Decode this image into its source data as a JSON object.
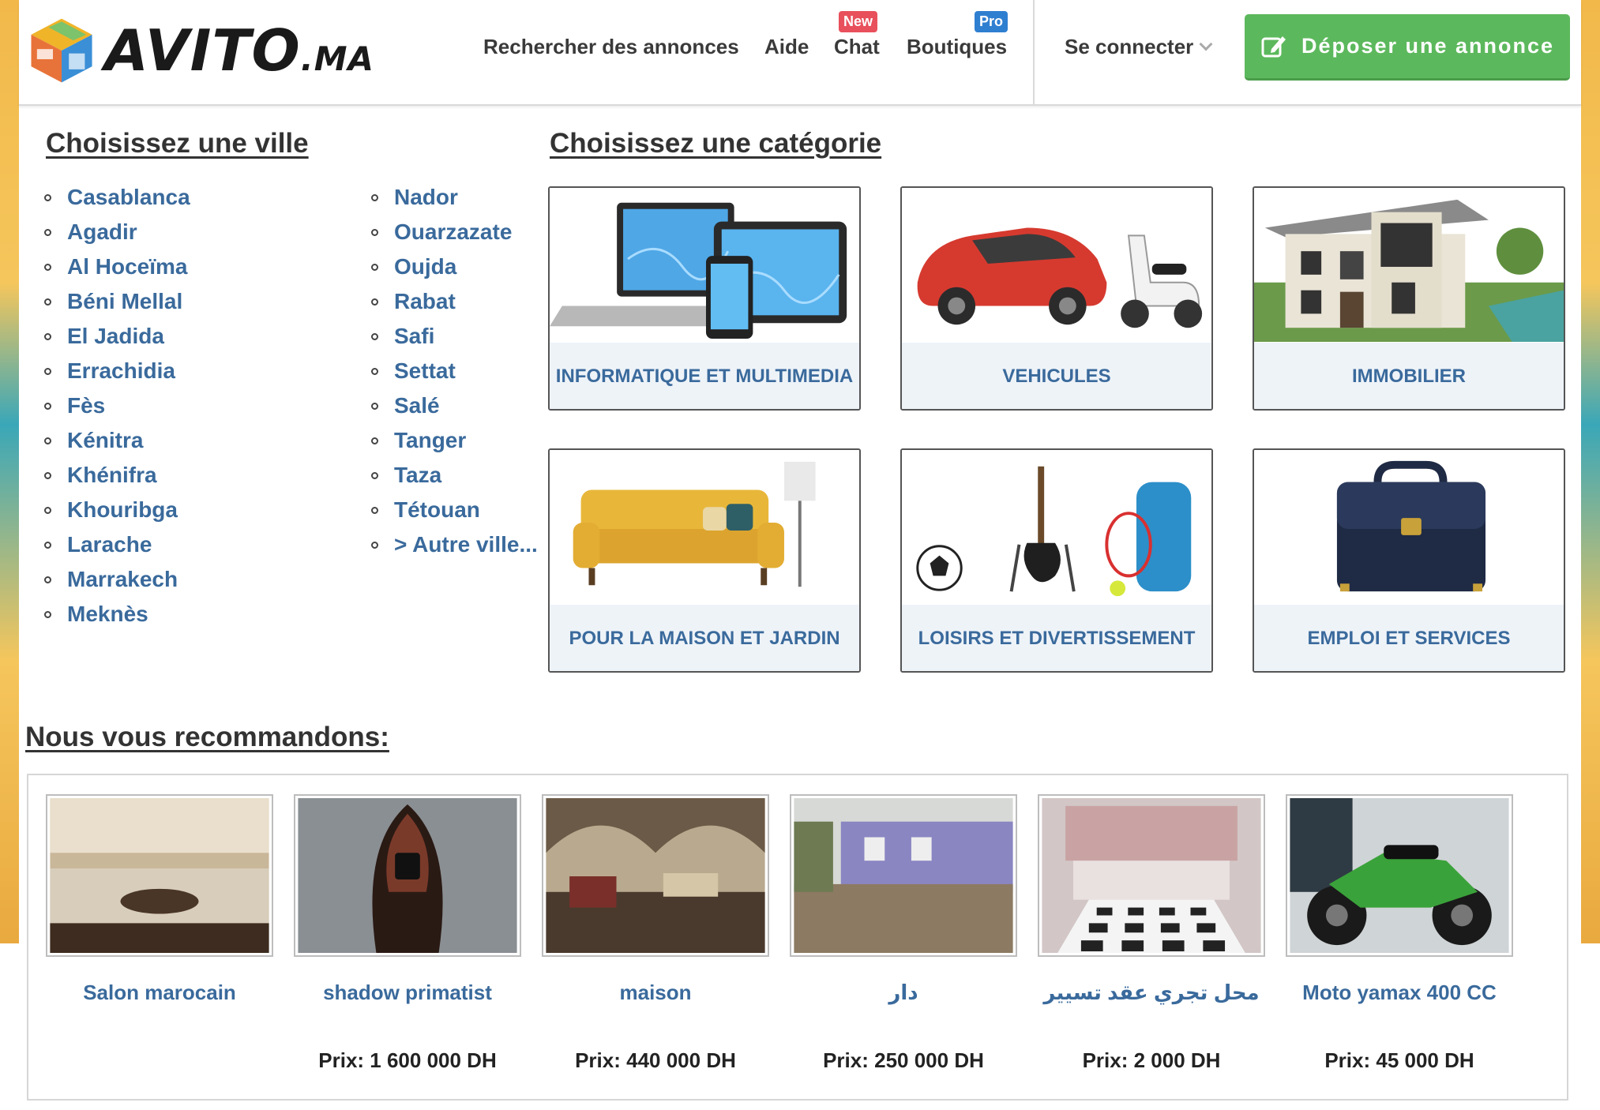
{
  "brand": {
    "name": "AVITO",
    "tld": ".MA",
    "green": "#5cb85c",
    "link_blue": "#3a6a9c"
  },
  "nav": {
    "search": "Rechercher des annonces",
    "help": "Aide",
    "chat": "Chat",
    "chat_badge": "New",
    "shops": "Boutiques",
    "shops_badge": "Pro",
    "login": "Se connecter",
    "post_ad": "Déposer une annonce"
  },
  "cities": {
    "heading": "Choisissez une ville",
    "col1": [
      "Casablanca",
      "Agadir",
      "Al Hoceïma",
      "Béni Mellal",
      "El Jadida",
      "Errachidia",
      "Fès",
      "Kénitra",
      "Khénifra",
      "Khouribga",
      "Larache",
      "Marrakech",
      "Meknès"
    ],
    "col2": [
      "Nador",
      "Ouarzazate",
      "Oujda",
      "Rabat",
      "Safi",
      "Settat",
      "Salé",
      "Tanger",
      "Taza",
      "Tétouan",
      "> Autre ville..."
    ]
  },
  "categories": {
    "heading": "Choisissez une catégorie",
    "items": [
      {
        "label": "INFORMATIQUE ET MULTIMEDIA",
        "icon": "laptop-tablet-phone-icon"
      },
      {
        "label": "VEHICULES",
        "icon": "car-scooter-icon"
      },
      {
        "label": "IMMOBILIER",
        "icon": "house-icon"
      },
      {
        "label": "POUR LA MAISON ET JARDIN",
        "icon": "sofa-icon"
      },
      {
        "label": "LOISIRS ET DIVERTISSEMENT",
        "icon": "sports-guitar-icon"
      },
      {
        "label": "EMPLOI ET SERVICES",
        "icon": "briefcase-icon"
      }
    ]
  },
  "recommendations": {
    "heading": "Nous vous recommandons:",
    "items": [
      {
        "title": "Salon marocain",
        "price": ""
      },
      {
        "title": "shadow primatist",
        "price": "Prix: 1 600 000 DH"
      },
      {
        "title": "maison",
        "price": "Prix: 440 000 DH"
      },
      {
        "title": "دار",
        "price": "Prix: 250 000 DH"
      },
      {
        "title": "محل تجري عقد تسيير",
        "price": "Prix: 2 000 DH"
      },
      {
        "title": "Moto yamax 400 CC",
        "price": "Prix: 45 000 DH"
      }
    ]
  }
}
